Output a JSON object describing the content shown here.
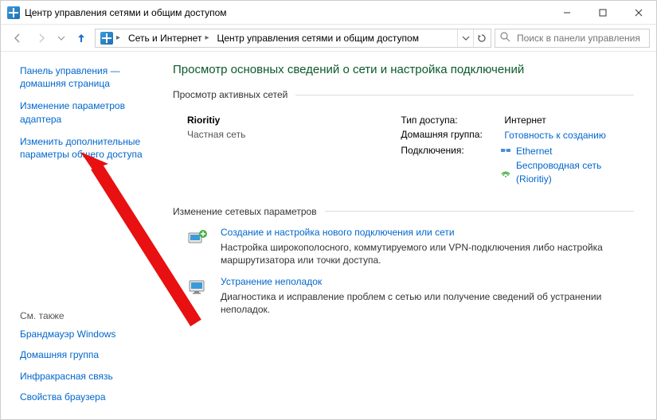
{
  "window": {
    "title": "Центр управления сетями и общим доступом"
  },
  "breadcrumb": {
    "item1": "Сеть и Интернет",
    "item2": "Центр управления сетями и общим доступом"
  },
  "search": {
    "placeholder": "Поиск в панели управления"
  },
  "sidebar": {
    "home": "Панель управления — домашняя страница",
    "adapter": "Изменение параметров адаптера",
    "advanced": "Изменить дополнительные параметры общего доступа",
    "seealso_header": "См. также",
    "seealso": {
      "firewall": "Брандмауэр Windows",
      "homegroup": "Домашняя группа",
      "infrared": "Инфракрасная связь",
      "browser": "Свойства браузера"
    }
  },
  "main": {
    "heading": "Просмотр основных сведений о сети и настройка подключений",
    "active_header": "Просмотр активных сетей",
    "network": {
      "name": "Rioritiy",
      "type": "Частная сеть",
      "props": {
        "access_label": "Тип доступа:",
        "access_value": "Интернет",
        "homegroup_label": "Домашняя группа:",
        "homegroup_value": "Готовность к созданию",
        "connections_label": "Подключения:",
        "conn_eth": "Ethernet",
        "conn_wifi": "Беспроводная сеть (Rioritiy)"
      }
    },
    "params_header": "Изменение сетевых параметров",
    "actions": {
      "newconn": {
        "title": "Создание и настройка нового подключения или сети",
        "desc": "Настройка широкополосного, коммутируемого или VPN-подключения либо настройка маршрутизатора или точки доступа."
      },
      "troubleshoot": {
        "title": "Устранение неполадок",
        "desc": "Диагностика и исправление проблем с сетью или получение сведений об устранении неполадок."
      }
    }
  }
}
